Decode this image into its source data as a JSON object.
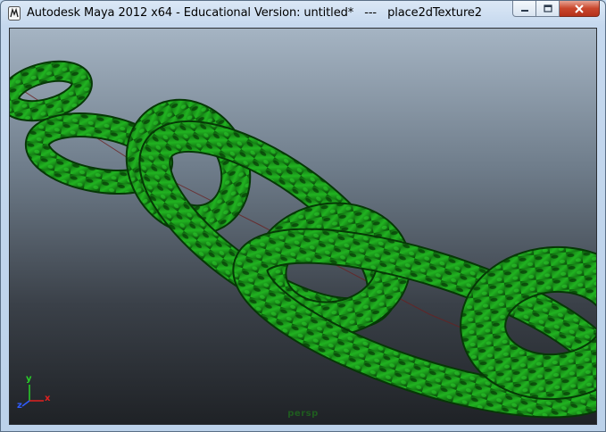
{
  "window": {
    "title": "Autodesk Maya 2012 x64 - Educational Version: untitled*   ---   place2dTexture2"
  },
  "viewport": {
    "camera": "persp",
    "axes": {
      "x": "x",
      "y": "y",
      "z": "z"
    },
    "object_color": "#1f9a1f",
    "background_top": "#a5b4c3",
    "background_bottom": "#1f2226"
  },
  "icons": [
    "maya-app-icon",
    "minimize-icon",
    "maximize-icon",
    "close-icon"
  ]
}
